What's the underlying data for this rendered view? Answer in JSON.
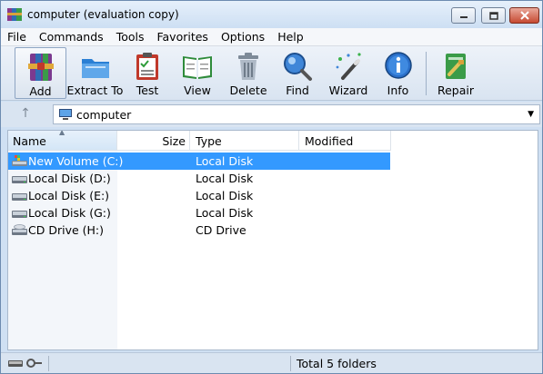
{
  "window": {
    "title": "computer (evaluation copy)"
  },
  "menu": [
    "File",
    "Commands",
    "Tools",
    "Favorites",
    "Options",
    "Help"
  ],
  "toolbar": {
    "buttons": [
      {
        "label": "Add",
        "icon": "add-archive-icon"
      },
      {
        "label": "Extract To",
        "icon": "extract-folder-icon"
      },
      {
        "label": "Test",
        "icon": "test-clipboard-icon"
      },
      {
        "label": "View",
        "icon": "view-book-icon"
      },
      {
        "label": "Delete",
        "icon": "trash-icon"
      },
      {
        "label": "Find",
        "icon": "magnifier-icon"
      },
      {
        "label": "Wizard",
        "icon": "magic-wand-icon"
      },
      {
        "label": "Info",
        "icon": "info-icon"
      },
      {
        "label": "Repair",
        "icon": "repair-icon"
      }
    ]
  },
  "address": {
    "path": "computer"
  },
  "columns": {
    "name": "Name",
    "size": "Size",
    "type": "Type",
    "modified": "Modified"
  },
  "files": [
    {
      "name": "New Volume (C:)",
      "size": "",
      "type": "Local Disk",
      "modified": "",
      "selected": true
    },
    {
      "name": "Local Disk (D:)",
      "size": "",
      "type": "Local Disk",
      "modified": "",
      "selected": false
    },
    {
      "name": "Local Disk (E:)",
      "size": "",
      "type": "Local Disk",
      "modified": "",
      "selected": false
    },
    {
      "name": "Local Disk (G:)",
      "size": "",
      "type": "Local Disk",
      "modified": "",
      "selected": false
    },
    {
      "name": "CD Drive (H:)",
      "size": "",
      "type": "CD Drive",
      "modified": "",
      "selected": false
    }
  ],
  "status": {
    "summary": "Total 5 folders"
  },
  "colors": {
    "selection": "#3399ff",
    "window_frame": "#cfe0f3",
    "close_button": "#c74a32"
  }
}
